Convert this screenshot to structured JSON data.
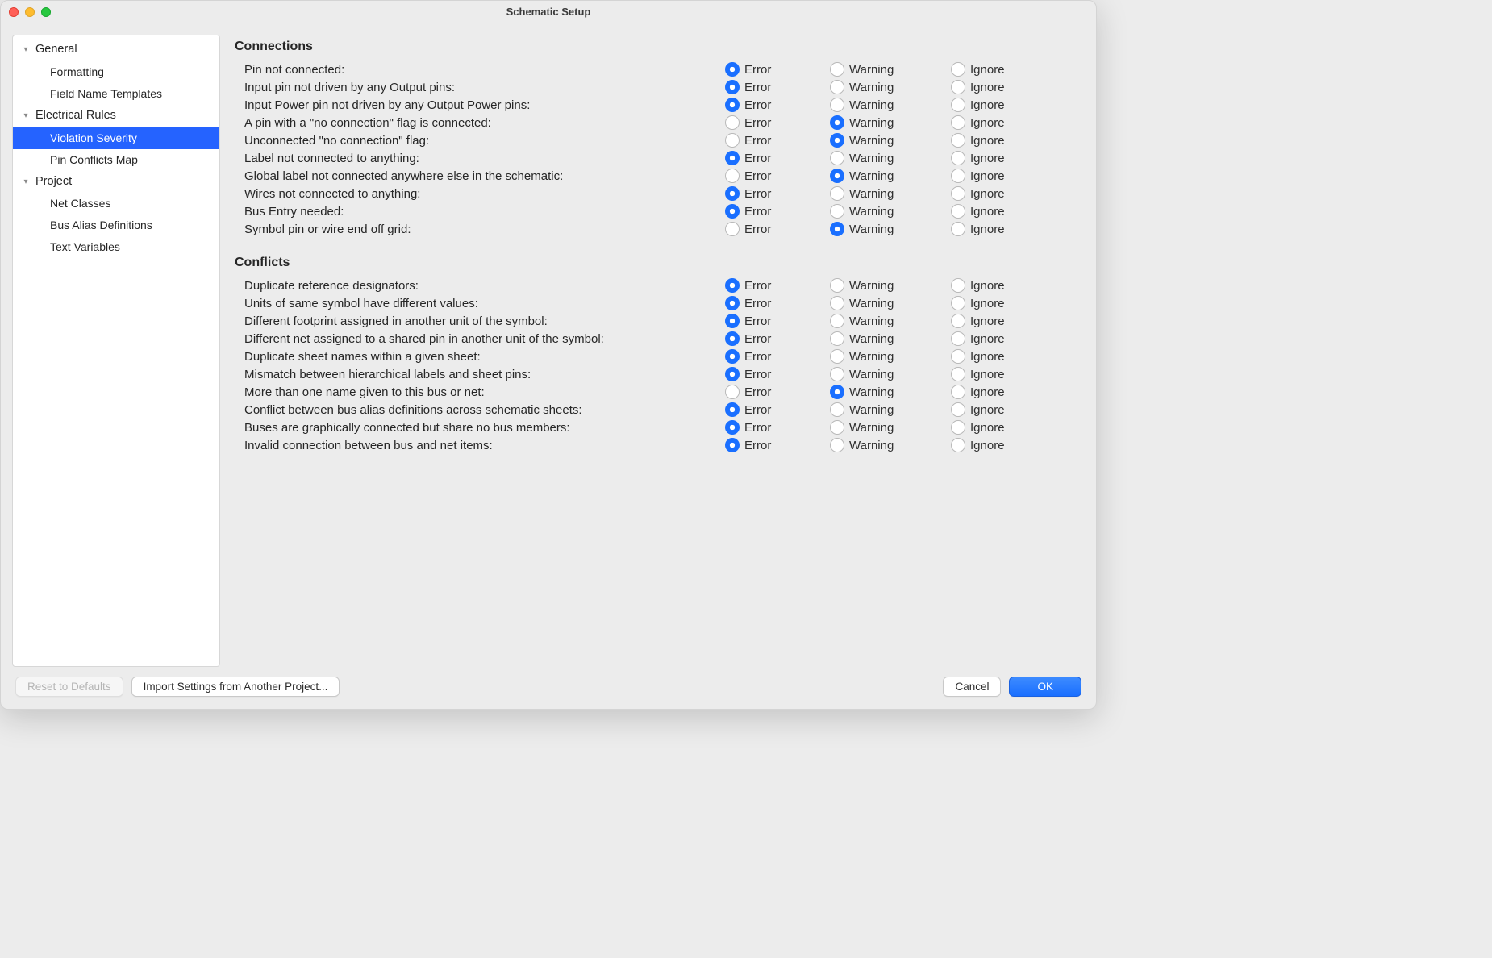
{
  "window": {
    "title": "Schematic Setup"
  },
  "sidebar": {
    "nodes": [
      {
        "label": "General",
        "level": 1,
        "expandable": true,
        "expanded": true,
        "selected": false
      },
      {
        "label": "Formatting",
        "level": 2,
        "expandable": false,
        "selected": false
      },
      {
        "label": "Field Name Templates",
        "level": 2,
        "expandable": false,
        "selected": false
      },
      {
        "label": "Electrical Rules",
        "level": 1,
        "expandable": true,
        "expanded": true,
        "selected": false
      },
      {
        "label": "Violation Severity",
        "level": 2,
        "expandable": false,
        "selected": true
      },
      {
        "label": "Pin Conflicts Map",
        "level": 2,
        "expandable": false,
        "selected": false
      },
      {
        "label": "Project",
        "level": 1,
        "expandable": true,
        "expanded": true,
        "selected": false
      },
      {
        "label": "Net Classes",
        "level": 2,
        "expandable": false,
        "selected": false
      },
      {
        "label": "Bus Alias Definitions",
        "level": 2,
        "expandable": false,
        "selected": false
      },
      {
        "label": "Text Variables",
        "level": 2,
        "expandable": false,
        "selected": false
      }
    ]
  },
  "severity": {
    "options": [
      "Error",
      "Warning",
      "Ignore"
    ],
    "groups": [
      {
        "title": "Connections",
        "rules": [
          {
            "label": "Pin not connected:",
            "value": "Error"
          },
          {
            "label": "Input pin not driven by any Output pins:",
            "value": "Error"
          },
          {
            "label": "Input Power pin not driven by any Output Power pins:",
            "value": "Error"
          },
          {
            "label": "A pin with a \"no connection\" flag is connected:",
            "value": "Warning"
          },
          {
            "label": "Unconnected \"no connection\" flag:",
            "value": "Warning"
          },
          {
            "label": "Label not connected to anything:",
            "value": "Error"
          },
          {
            "label": "Global label not connected anywhere else in the schematic:",
            "value": "Warning"
          },
          {
            "label": "Wires not connected to anything:",
            "value": "Error"
          },
          {
            "label": "Bus Entry needed:",
            "value": "Error"
          },
          {
            "label": "Symbol pin or wire end off grid:",
            "value": "Warning"
          }
        ]
      },
      {
        "title": "Conflicts",
        "rules": [
          {
            "label": "Duplicate reference designators:",
            "value": "Error"
          },
          {
            "label": "Units of same symbol have different values:",
            "value": "Error"
          },
          {
            "label": "Different footprint assigned in another unit of the symbol:",
            "value": "Error"
          },
          {
            "label": "Different net assigned to a shared pin in another unit of the symbol:",
            "value": "Error"
          },
          {
            "label": "Duplicate sheet names within a given sheet:",
            "value": "Error"
          },
          {
            "label": "Mismatch between hierarchical labels and sheet pins:",
            "value": "Error"
          },
          {
            "label": "More than one name given to this bus or net:",
            "value": "Warning"
          },
          {
            "label": "Conflict between bus alias definitions across schematic sheets:",
            "value": "Error"
          },
          {
            "label": "Buses are graphically connected but share no bus members:",
            "value": "Error"
          },
          {
            "label": "Invalid connection between bus and net items:",
            "value": "Error"
          }
        ]
      }
    ]
  },
  "footer": {
    "reset": "Reset to Defaults",
    "import": "Import Settings from Another Project...",
    "cancel": "Cancel",
    "ok": "OK"
  }
}
